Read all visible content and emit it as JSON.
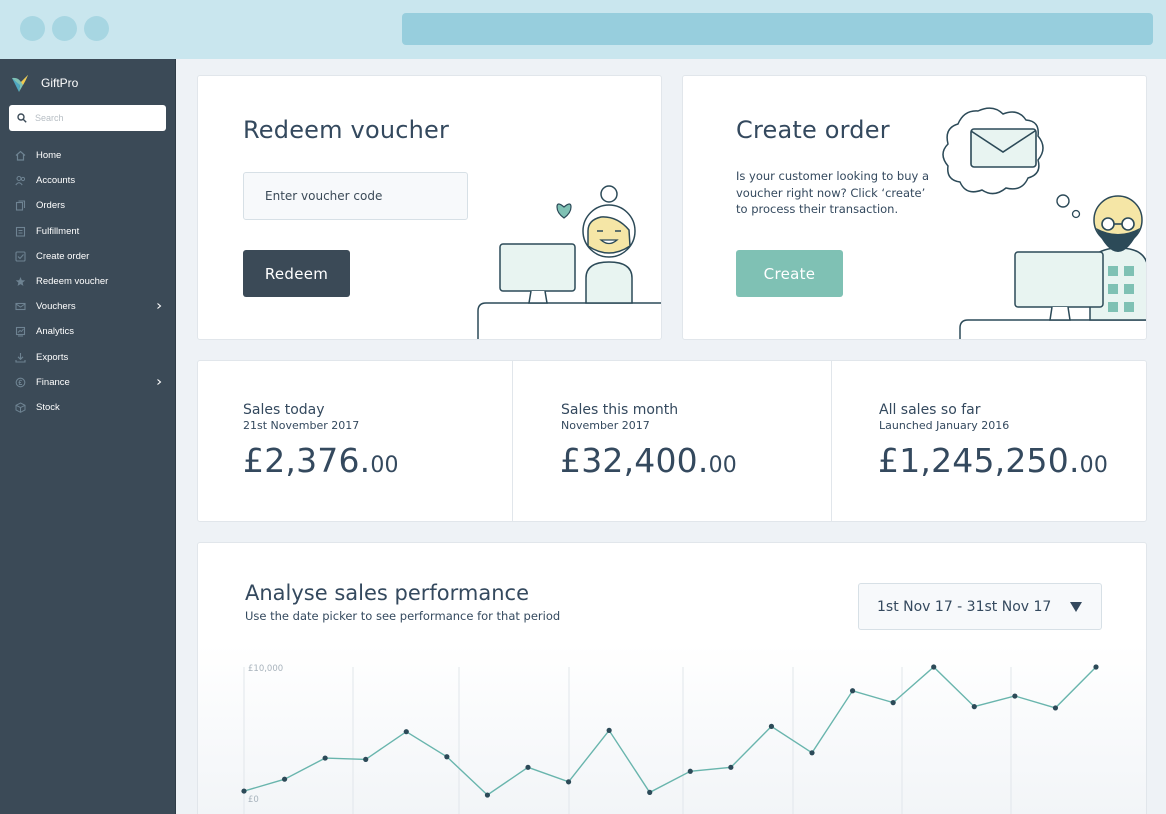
{
  "brand": {
    "name": "GiftPro"
  },
  "search": {
    "placeholder": "Search"
  },
  "sidebar": {
    "items": [
      {
        "label": "Home",
        "icon": "home-icon",
        "has_submenu": false
      },
      {
        "label": "Accounts",
        "icon": "users-icon",
        "has_submenu": false
      },
      {
        "label": "Orders",
        "icon": "orders-icon",
        "has_submenu": false
      },
      {
        "label": "Fulfillment",
        "icon": "fulfillment-icon",
        "has_submenu": false
      },
      {
        "label": "Create order",
        "icon": "create-order-icon",
        "has_submenu": false
      },
      {
        "label": "Redeem voucher",
        "icon": "star-icon",
        "has_submenu": false
      },
      {
        "label": "Vouchers",
        "icon": "voucher-icon",
        "has_submenu": true
      },
      {
        "label": "Analytics",
        "icon": "analytics-icon",
        "has_submenu": false
      },
      {
        "label": "Exports",
        "icon": "download-icon",
        "has_submenu": false
      },
      {
        "label": "Finance",
        "icon": "finance-icon",
        "has_submenu": true
      },
      {
        "label": "Stock",
        "icon": "box-icon",
        "has_submenu": false
      }
    ]
  },
  "redeem": {
    "title": "Redeem voucher",
    "input_placeholder": "Enter voucher code",
    "button_label": "Redeem"
  },
  "order": {
    "title": "Create order",
    "description": "Is your customer looking to buy a voucher right now? Click ‘create’ to process their transaction.",
    "button_label": "Create"
  },
  "stats": [
    {
      "label": "Sales today",
      "sub": "21st November 2017",
      "value_main": "£2,376.",
      "value_pence": "00"
    },
    {
      "label": "Sales this month",
      "sub": "November 2017",
      "value_main": "£32,400.",
      "value_pence": "00"
    },
    {
      "label": "All sales so far",
      "sub": "Launched January 2016",
      "value_main": "£1,245,250.",
      "value_pence": "00"
    }
  ],
  "analyse": {
    "title": "Analyse sales performance",
    "subtitle": "Use the date picker to see performance for that period",
    "date_range": "1st Nov 17 - 31st Nov 17"
  },
  "colors": {
    "sidebar": "#3b4a57",
    "accent": "#7fc1b4",
    "line": "#69b5ad",
    "point": "#2c4a58",
    "text": "#34495e"
  },
  "chart_data": {
    "type": "line",
    "y_tick_labels": [
      "£10,000",
      "£0"
    ],
    "ylim": [
      0,
      10000
    ],
    "values": [
      600,
      1500,
      3100,
      3000,
      5100,
      3200,
      300,
      2400,
      1300,
      5200,
      500,
      2100,
      2400,
      5500,
      3500,
      8200,
      7300,
      10000,
      7000,
      7800,
      6900,
      10000
    ],
    "grid": "vertical",
    "legend": "none"
  }
}
